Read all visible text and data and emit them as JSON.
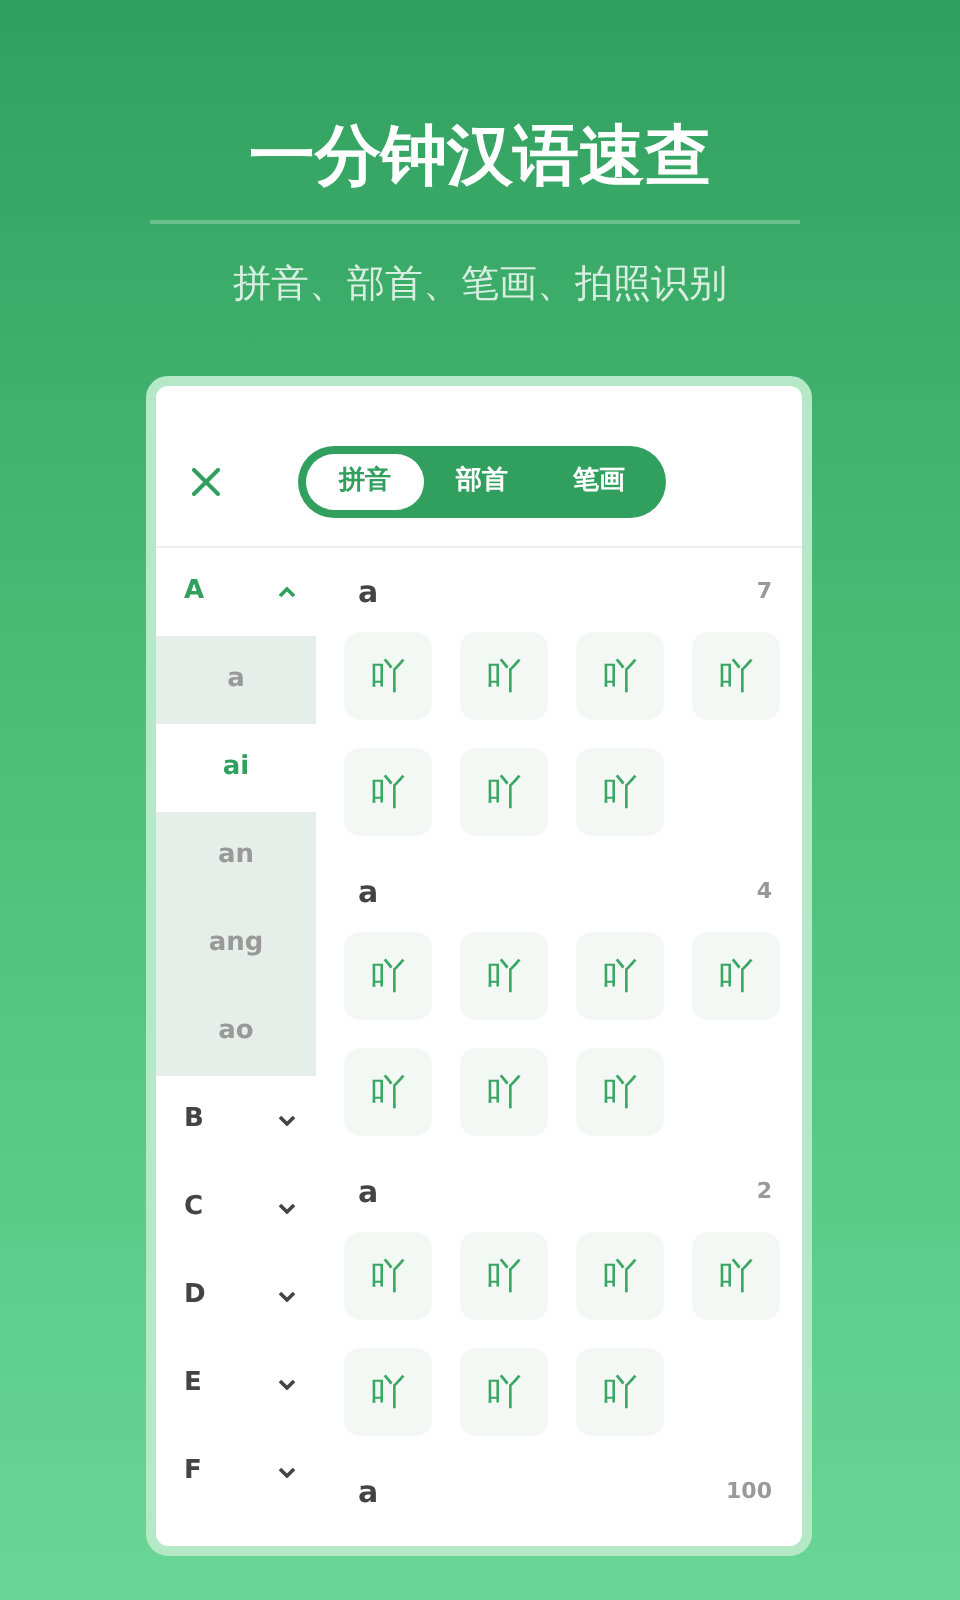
{
  "title": "一分钟汉语速查",
  "subtitle": "拼音、部首、笔画、拍照识别",
  "tabs": [
    {
      "label": "拼音",
      "selected": true
    },
    {
      "label": "部首",
      "selected": false
    },
    {
      "label": "笔画",
      "selected": false
    }
  ],
  "sidebar": [
    {
      "letter": "A",
      "expanded": true,
      "children": [
        {
          "label": "a",
          "selected": false
        },
        {
          "label": "ai",
          "selected": true
        },
        {
          "label": "an",
          "selected": false
        },
        {
          "label": "ang",
          "selected": false
        },
        {
          "label": "ao",
          "selected": false
        }
      ]
    },
    {
      "letter": "B",
      "expanded": false
    },
    {
      "letter": "C",
      "expanded": false
    },
    {
      "letter": "D",
      "expanded": false
    },
    {
      "letter": "E",
      "expanded": false
    },
    {
      "letter": "F",
      "expanded": false
    }
  ],
  "sections": [
    {
      "pinyin": "a",
      "count": "7",
      "characters": [
        "吖",
        "吖",
        "吖",
        "吖",
        "吖",
        "吖",
        "吖"
      ]
    },
    {
      "pinyin": "a",
      "count": "4",
      "characters": [
        "吖",
        "吖",
        "吖",
        "吖",
        "吖",
        "吖",
        "吖"
      ]
    },
    {
      "pinyin": "a",
      "count": "2",
      "characters": [
        "吖",
        "吖",
        "吖",
        "吖",
        "吖",
        "吖",
        "吖"
      ]
    },
    {
      "pinyin": "a",
      "count": "100"
    }
  ]
}
